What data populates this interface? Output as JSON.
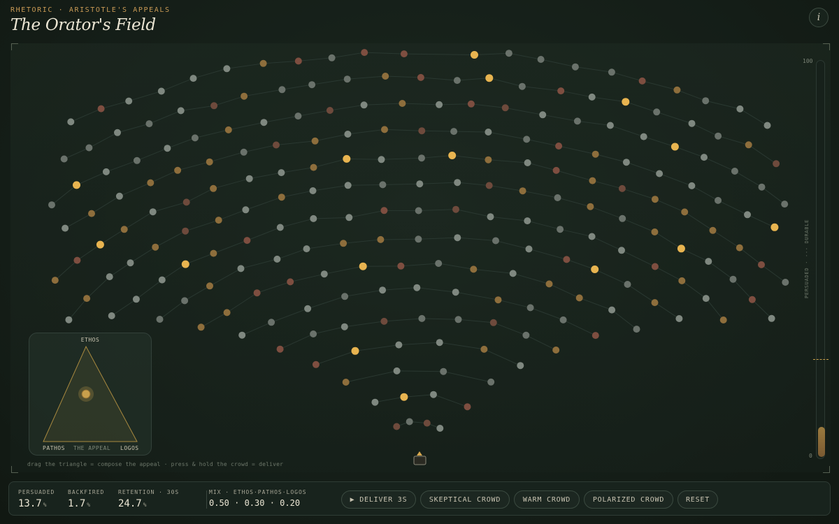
{
  "header": {
    "eyebrow": "RHETORIC · ARISTOTLE'S APPEALS",
    "title": "The Orator's Field",
    "info_label": "i"
  },
  "crowd": {
    "colors": {
      "neutral": "#7f8880",
      "neutral_dim": "#6a726b",
      "skeptic": "#6e4a3c",
      "skeptic_alt": "#7e4e40",
      "warming": "#8e6e3c",
      "persuaded": "#e8b450",
      "link": "#2a3831"
    }
  },
  "triangle": {
    "top_label": "ETHOS",
    "left_label": "PATHOS",
    "center_label": "THE APPEAL",
    "right_label": "LOGOS",
    "mix": {
      "ethos": 0.5,
      "pathos": 0.3,
      "logos": 0.2
    },
    "accent": "#c9a04c"
  },
  "hint": "drag the triangle = compose the appeal · press & hold the crowd = deliver",
  "meter": {
    "max_label": "100",
    "min_label": "0",
    "caption": "PERSUADED · --- DURABLE",
    "persuaded_fraction": 0.137,
    "durable_fraction": 0.247
  },
  "stats": {
    "persuaded": {
      "label": "PERSUADED",
      "value": "13.7",
      "unit": "%"
    },
    "backfired": {
      "label": "BACKFIRED",
      "value": "1.7",
      "unit": "%"
    },
    "retention": {
      "label": "RETENTION · 30S",
      "value": "24.7",
      "unit": "%"
    },
    "mix": {
      "label": "MIX · ETHOS·PATHOS·LOGOS",
      "value": "0.50 · 0.30 · 0.20"
    }
  },
  "actions": {
    "deliver": "▶ DELIVER 3S",
    "skeptical": "SKEPTICAL CROWD",
    "warm": "WARM CROWD",
    "polarized": "POLARIZED CROWD",
    "reset": "RESET"
  }
}
